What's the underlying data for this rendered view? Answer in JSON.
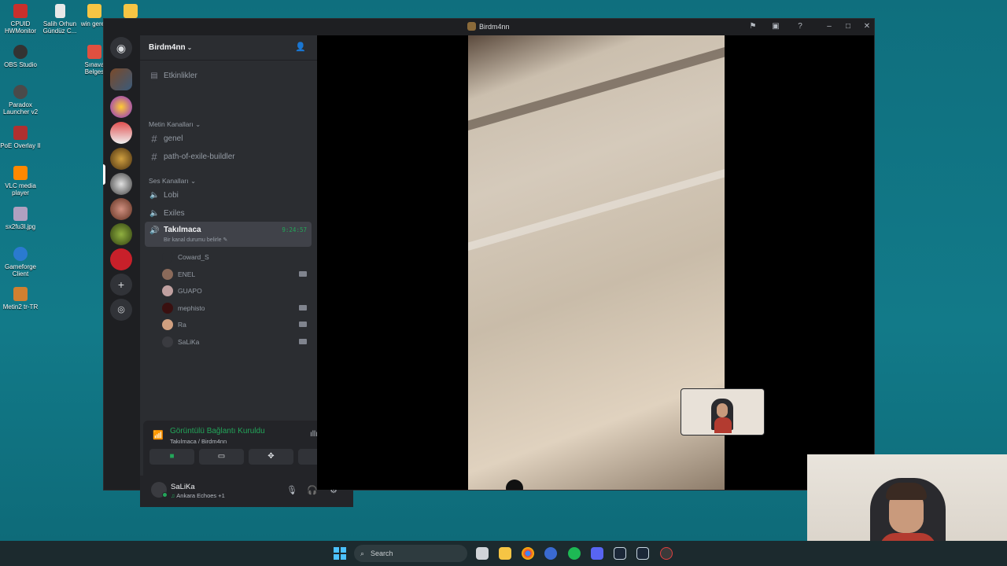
{
  "window": {
    "title": "Birdm4nn"
  },
  "desktop": {
    "icons": [
      {
        "label": "CPUID HWMonitor",
        "color": "#c9302c"
      },
      {
        "label": "Salih Orhun Gündüz C...",
        "color": "#e8e8e8"
      },
      {
        "label": "win gerek",
        "color": "#f6c544"
      },
      {
        "label": "OBS Studio",
        "color": "#333333"
      },
      {
        "label": "Sınava Belges",
        "color": "#e05040"
      },
      {
        "label": "Paradox Launcher v2",
        "color": "#4a4a4a"
      },
      {
        "label": "PoE Overlay II",
        "color": "#b03030"
      },
      {
        "label": "VLC media player",
        "color": "#ff8800"
      },
      {
        "label": "sx2fu3l.jpg",
        "color": "#b0a0c0"
      },
      {
        "label": "Gameforge Client",
        "color": "#2a7ad0"
      },
      {
        "label": "Metin2 tr-TR",
        "color": "#d08030"
      }
    ]
  },
  "server": {
    "name": "Birdm4nn"
  },
  "channels": {
    "events": "Etkinlikler",
    "text_category": "Metin Kanalları",
    "text": [
      "genel",
      "path-of-exile-buildler"
    ],
    "voice_category": "Ses Kanalları",
    "voice": [
      "Lobi",
      "Exiles"
    ],
    "active_voice": {
      "name": "Takılmaca",
      "status": "Bir kanal durumu belirle",
      "timer": "9:24:57"
    }
  },
  "members": [
    {
      "name": "Coward_S",
      "color": "#2b2d31",
      "cam": false
    },
    {
      "name": "ENEL",
      "color": "#8a6a5a",
      "cam": true
    },
    {
      "name": "GUAPO",
      "color": "#c0a0a0",
      "cam": false
    },
    {
      "name": "mephisto",
      "color": "#3a1010",
      "cam": true
    },
    {
      "name": "Ra",
      "color": "#d0a080",
      "cam": true
    },
    {
      "name": "SaLiKa",
      "color": "#3a3b40",
      "cam": true
    }
  ],
  "voice_panel": {
    "status": "Görüntülü Bağlantı Kuruldu",
    "location": "Takılmaca / Birdm4nn"
  },
  "user": {
    "name": "SaLiKa",
    "activity": "Ankara Echoes +1"
  },
  "taskbar": {
    "search_placeholder": "Search"
  },
  "colors": {
    "online": "#23a559",
    "blurple": "#5865f2"
  }
}
